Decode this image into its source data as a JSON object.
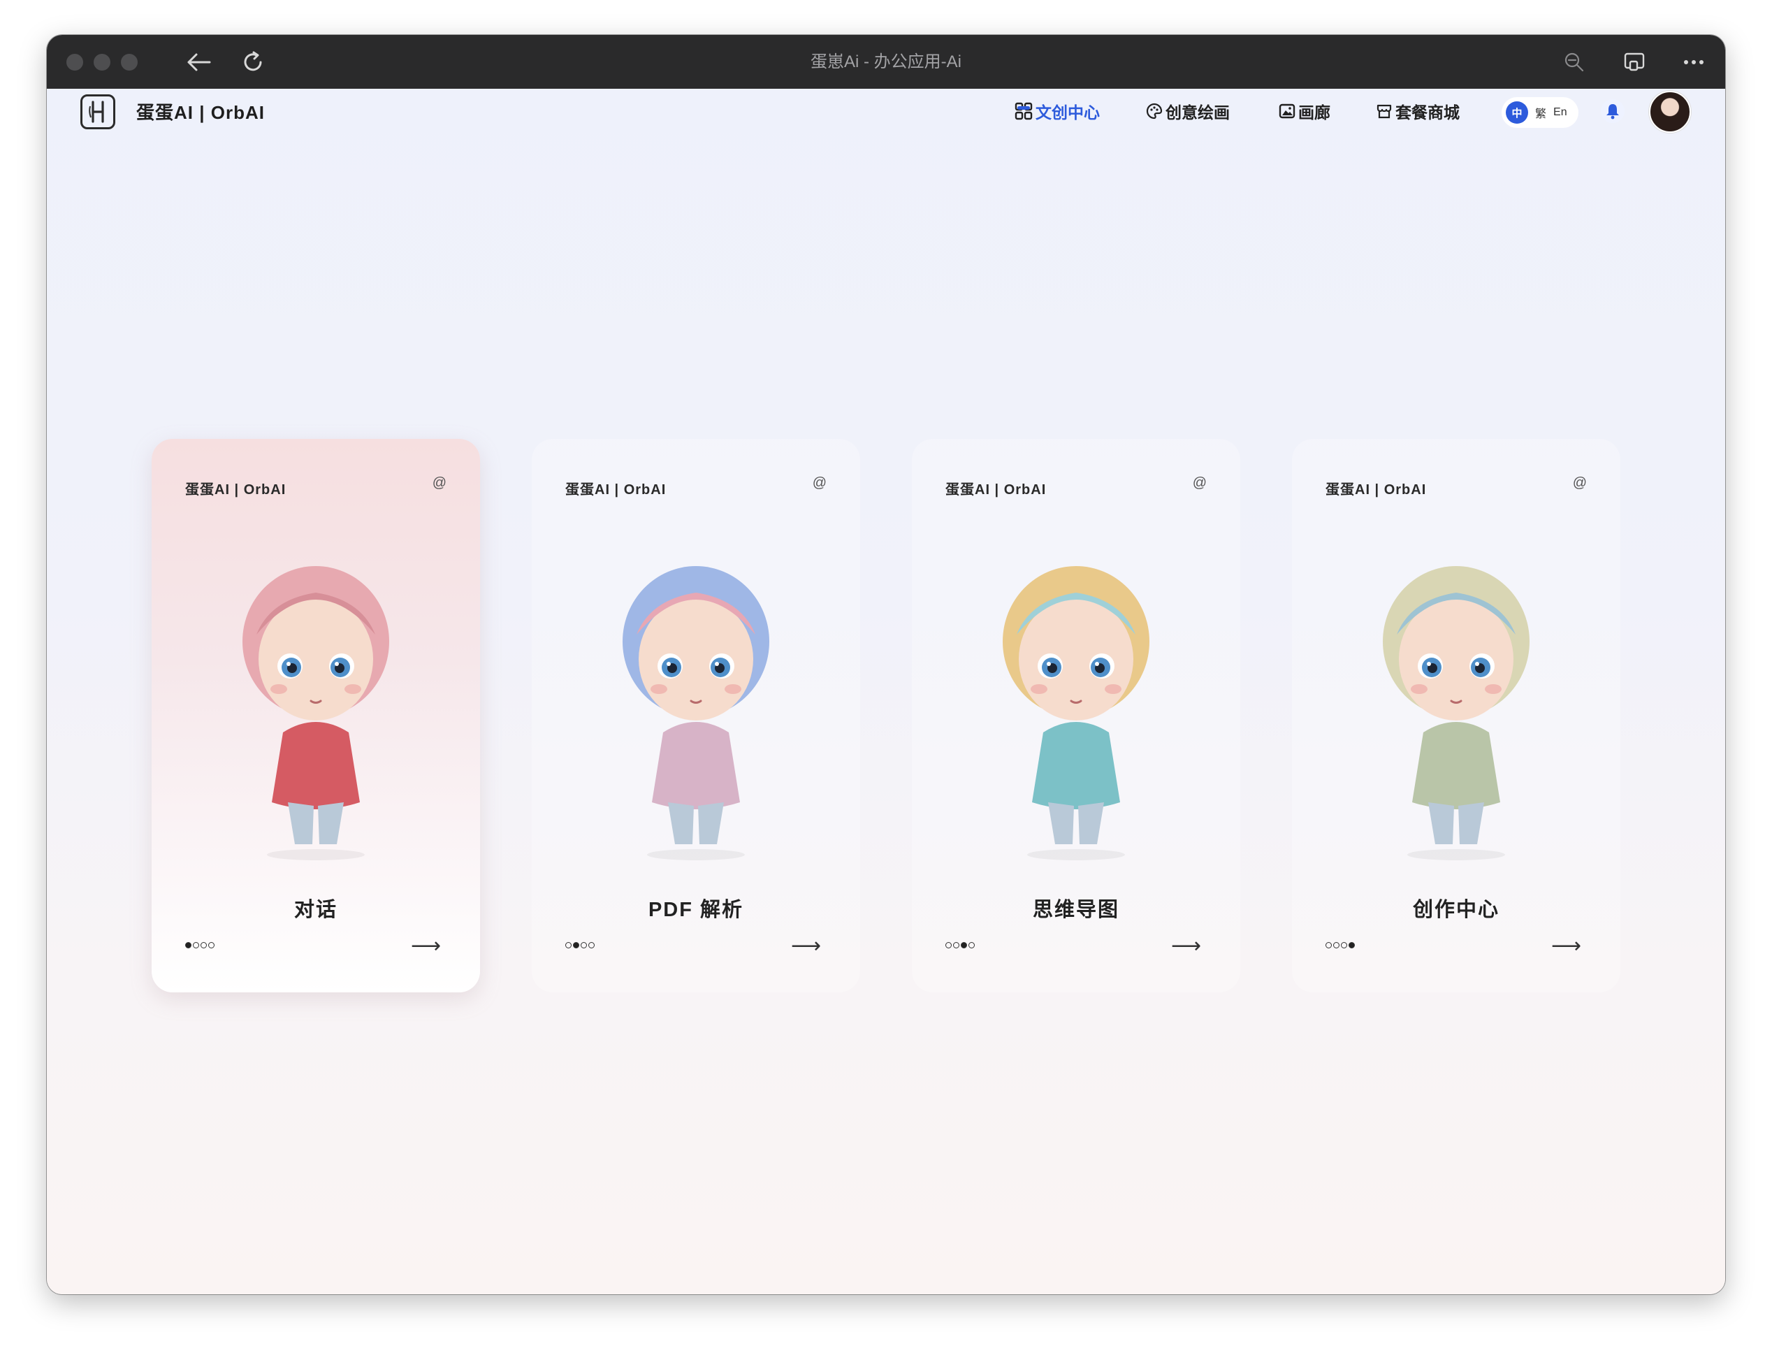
{
  "window": {
    "title": "蛋崽Ai - 办公应用-Ai"
  },
  "icons": {
    "back": "arrow-left-icon",
    "reload": "reload-icon",
    "zoom": "zoom-out-icon",
    "cast": "cast-icon",
    "more": "more-icon"
  },
  "header": {
    "brand": "蛋蛋AI | OrbAI",
    "nav": [
      {
        "label": "文创中心",
        "icon": "grid-icon",
        "active": true
      },
      {
        "label": "创意绘画",
        "icon": "palette-icon",
        "active": false
      },
      {
        "label": "画廊",
        "icon": "gallery-icon",
        "active": false
      },
      {
        "label": "套餐商城",
        "icon": "store-icon",
        "active": false
      }
    ],
    "lang": {
      "zh": "中",
      "tw": "繁",
      "en": "En"
    }
  },
  "cards": [
    {
      "brand": "蛋蛋AI | OrbAI",
      "at": "@",
      "title": "对话",
      "active_dot": 0,
      "arrow": "⟶"
    },
    {
      "brand": "蛋蛋AI | OrbAI",
      "at": "@",
      "title": "PDF 解析",
      "active_dot": 1,
      "arrow": "⟶"
    },
    {
      "brand": "蛋蛋AI | OrbAI",
      "at": "@",
      "title": "思维导图",
      "active_dot": 2,
      "arrow": "⟶"
    },
    {
      "brand": "蛋蛋AI | OrbAI",
      "at": "@",
      "title": "创作中心",
      "active_dot": 3,
      "arrow": "⟶"
    }
  ],
  "colors": {
    "accent": "#2d5bdc",
    "titlebar": "#2a2a2b"
  }
}
